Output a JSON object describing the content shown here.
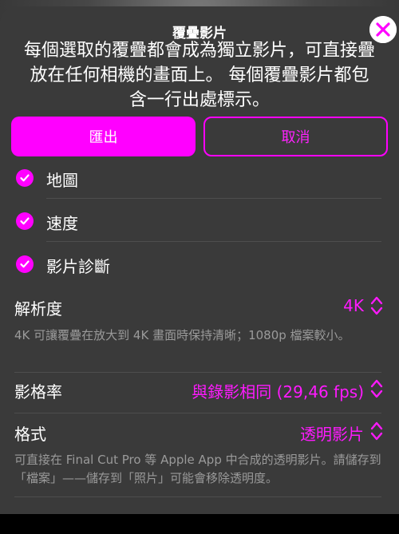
{
  "sheet": {
    "title": "覆疊影片",
    "description": "每個選取的覆疊都會成為獨立影片，可直接疊放在任何相機的畫面上。 每個覆疊影片都包含一行出處標示。"
  },
  "buttons": {
    "export_label": "匯出",
    "cancel_label": "取消"
  },
  "overlays": [
    {
      "label": "地圖",
      "checked": true
    },
    {
      "label": "速度",
      "checked": true
    },
    {
      "label": "影片診斷",
      "checked": true
    }
  ],
  "settings": {
    "resolution": {
      "label": "解析度",
      "value": "4K",
      "note": "4K 可讓覆疊在放大到 4K 畫面時保持清晰；1080p 檔案較小。"
    },
    "frame_rate": {
      "label": "影格率",
      "value": "與錄影相同 (29,46 fps)"
    },
    "format": {
      "label": "格式",
      "value": "透明影片",
      "note": "可直接在 Final Cut Pro 等 Apple App 中合成的透明影片。請儲存到「檔案」——儲存到「照片」可能會移除透明度。"
    }
  },
  "colors": {
    "accent": "#ff00ff",
    "sheet_background": "#3a3a3a",
    "secondary_text": "#9a9a9a"
  },
  "icons": {
    "close": "close-icon",
    "check": "checkmark-icon",
    "picker": "chevron-up-down-icon"
  }
}
